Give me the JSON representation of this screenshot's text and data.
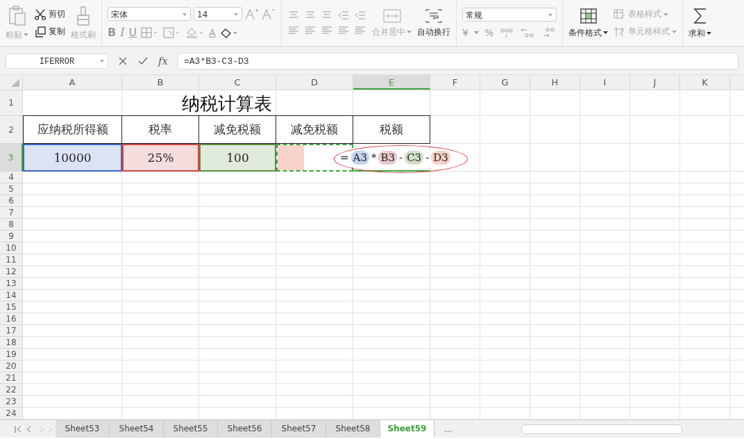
{
  "toolbar": {
    "clipboard": [
      {
        "label": "粘贴",
        "disabled": true
      },
      {
        "label": "剪切",
        "disabled": false
      },
      {
        "label": "复制",
        "disabled": false
      },
      {
        "label": "格式刷",
        "disabled": true
      }
    ],
    "font": {
      "name": "宋体",
      "size": "14",
      "styles": [
        "B",
        "I",
        "U",
        "A"
      ]
    },
    "alignment": [
      {
        "label": "合并居中",
        "disabled": true
      },
      {
        "label": "自动换行",
        "disabled": false
      }
    ],
    "number": {
      "format": "常规",
      "currency": "¥",
      "percent": "%"
    },
    "styles": [
      {
        "label": "条件格式",
        "disabled": false
      },
      {
        "label": "表格样式",
        "disabled": true
      },
      {
        "label": "单元格样式",
        "disabled": true
      }
    ],
    "sum": {
      "label": "求和",
      "disabled": false
    }
  },
  "formula_bar": {
    "name_box": "IFERROR",
    "function_label": "fx",
    "formula": "=A3*B3-C3-D3"
  },
  "columns": [
    {
      "label": "A",
      "selected": false
    },
    {
      "label": "B",
      "selected": false
    },
    {
      "label": "C",
      "selected": false
    },
    {
      "label": "D",
      "selected": false
    },
    {
      "label": "E",
      "selected": true
    },
    {
      "label": "F",
      "selected": false
    },
    {
      "label": "G",
      "selected": false
    },
    {
      "label": "H",
      "selected": false
    },
    {
      "label": "I",
      "selected": false
    },
    {
      "label": "J",
      "selected": false
    },
    {
      "label": "K",
      "selected": false
    }
  ],
  "rows": [
    {
      "label": "1",
      "selected": false
    },
    {
      "label": "2",
      "selected": false
    },
    {
      "label": "3",
      "selected": true
    },
    {
      "label": "4",
      "selected": false
    },
    {
      "label": "5",
      "selected": false
    },
    {
      "label": "6",
      "selected": false
    },
    {
      "label": "7",
      "selected": false
    },
    {
      "label": "8",
      "selected": false
    },
    {
      "label": "9",
      "selected": false
    },
    {
      "label": "10",
      "selected": false
    },
    {
      "label": "11",
      "selected": false
    },
    {
      "label": "12",
      "selected": false
    },
    {
      "label": "13",
      "selected": false
    },
    {
      "label": "14",
      "selected": false
    },
    {
      "label": "15",
      "selected": false
    },
    {
      "label": "16",
      "selected": false
    },
    {
      "label": "17",
      "selected": false
    },
    {
      "label": "18",
      "selected": false
    },
    {
      "label": "19",
      "selected": false
    },
    {
      "label": "20",
      "selected": false
    },
    {
      "label": "21",
      "selected": false
    },
    {
      "label": "22",
      "selected": false
    },
    {
      "label": "23",
      "selected": false
    },
    {
      "label": "24",
      "selected": false
    }
  ],
  "sheet": {
    "title": "纳税计算表",
    "headers": [
      "应纳税所得额",
      "税率",
      "减免税额",
      "减免税额",
      "税额"
    ],
    "values": [
      {
        "text": "10000",
        "color": "#3b63c8"
      },
      {
        "text": "25%",
        "color": "#cc4444"
      },
      {
        "text": "100",
        "color": "#5a8f3c"
      },
      {
        "color": "#f7d3ca"
      }
    ],
    "editing_formula": [
      {
        "text": "="
      },
      {
        "text": "A3",
        "color": "#c7d4ef"
      },
      {
        "text": "*"
      },
      {
        "text": "B3",
        "color": "#ebcacb"
      },
      {
        "text": "-"
      },
      {
        "text": "C3",
        "color": "#cfdec8"
      },
      {
        "text": "-"
      },
      {
        "text": "D3",
        "color": "#f6d0c5"
      }
    ]
  },
  "sheet_tabs": [
    {
      "label": "Sheet53",
      "selected": false
    },
    {
      "label": "Sheet54",
      "selected": false
    },
    {
      "label": "Sheet55",
      "selected": false
    },
    {
      "label": "Sheet56",
      "selected": false
    },
    {
      "label": "Sheet57",
      "selected": false
    },
    {
      "label": "Sheet58",
      "selected": false
    },
    {
      "label": "Sheet59",
      "selected": true
    }
  ],
  "more_tabs": "..."
}
